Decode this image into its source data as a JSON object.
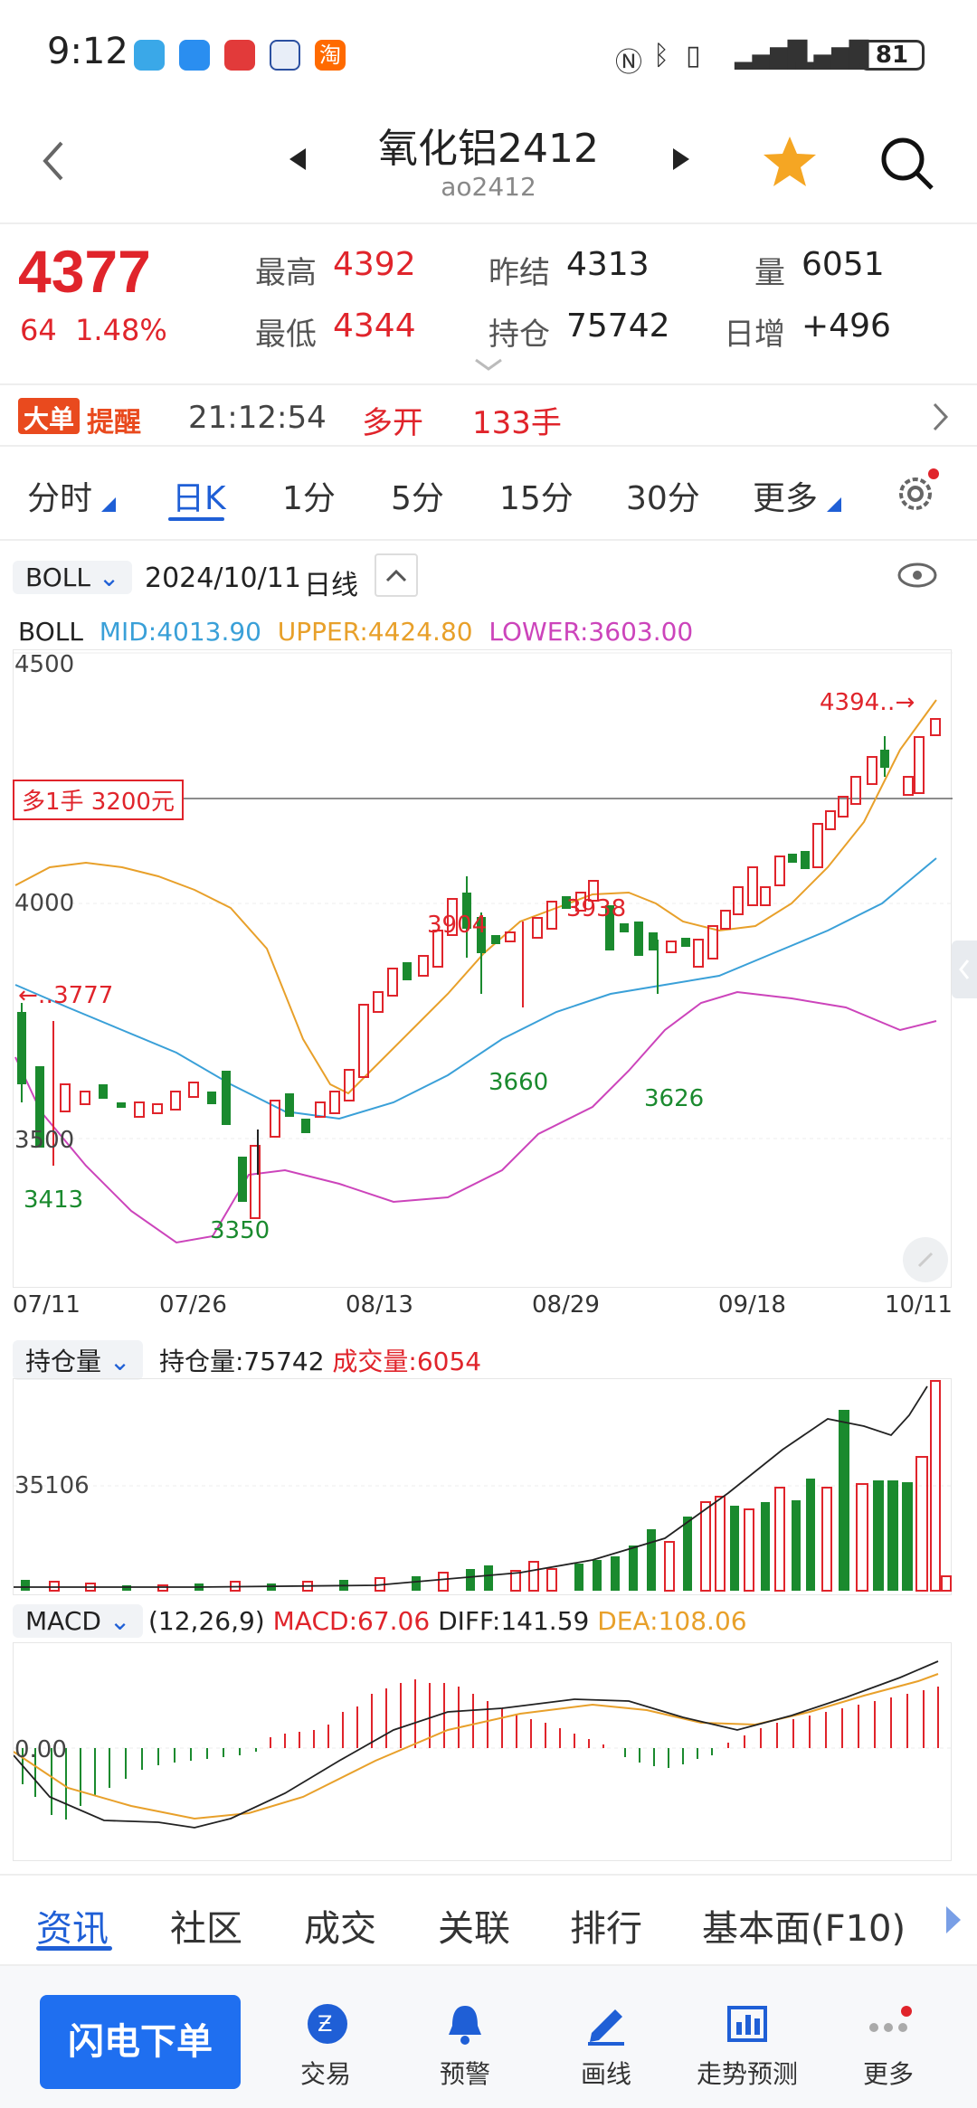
{
  "status": {
    "time": "9:12",
    "battery": "81"
  },
  "header": {
    "title": "氧化铝2412",
    "code": "ao2412"
  },
  "quote": {
    "price": "4377",
    "change": "64",
    "change_pct": "1.48%",
    "high_label": "最高",
    "high": "4392",
    "low_label": "最低",
    "low": "4344",
    "prev_label": "昨结",
    "prev": "4313",
    "oi_label": "持仓",
    "oi": "75742",
    "vol_label": "量",
    "vol": "6051",
    "daily_label": "日增",
    "daily": "+496"
  },
  "alert": {
    "badge_a": "大单",
    "badge_b": "提醒",
    "time": "21:12:54",
    "action": "多开",
    "qty": "133手"
  },
  "periods": [
    "分时",
    "日K",
    "1分",
    "5分",
    "15分",
    "30分",
    "更多"
  ],
  "chart_bar": {
    "indicator": "BOLL",
    "date": "2024/10/11",
    "period": "日线"
  },
  "boll_legend": {
    "name": "BOLL",
    "mid": "MID:4013.90",
    "upper": "UPPER:4424.80",
    "lower": "LOWER:3603.00"
  },
  "position_tag": "多1手  3200元",
  "price_axis": {
    "top": "4500",
    "mid": "4000",
    "low": "3500"
  },
  "annotations": {
    "left_mark": "3777",
    "top_right": "4394",
    "a1": "3904",
    "a2": "3938",
    "a3": "3660",
    "a4": "3626",
    "a5": "3413",
    "a6": "3350"
  },
  "dates": [
    "07/11",
    "07/26",
    "08/13",
    "08/29",
    "09/18",
    "10/11"
  ],
  "vol_bar": {
    "indicator": "持仓量",
    "oi_text": "持仓量:75742",
    "vol_text": "成交量:6054",
    "axis": "35106"
  },
  "macd_bar": {
    "indicator": "MACD",
    "params": "(12,26,9)",
    "macd": "MACD:67.06",
    "diff": "DIFF:141.59",
    "dea": "DEA:108.06",
    "zero": "0.00"
  },
  "bottom_tabs": [
    "资讯",
    "社区",
    "成交",
    "关联",
    "排行",
    "基本面(F10)"
  ],
  "nav": {
    "quick": "闪电下单",
    "items": [
      "交易",
      "预警",
      "画线",
      "走势预测",
      "更多"
    ]
  },
  "colors": {
    "up": "#e0242b",
    "down": "#1a8a2e",
    "accent": "#1f5fd6",
    "mid": "#3aa0d8",
    "upper": "#e8a02a",
    "lower": "#cc44bb"
  }
}
